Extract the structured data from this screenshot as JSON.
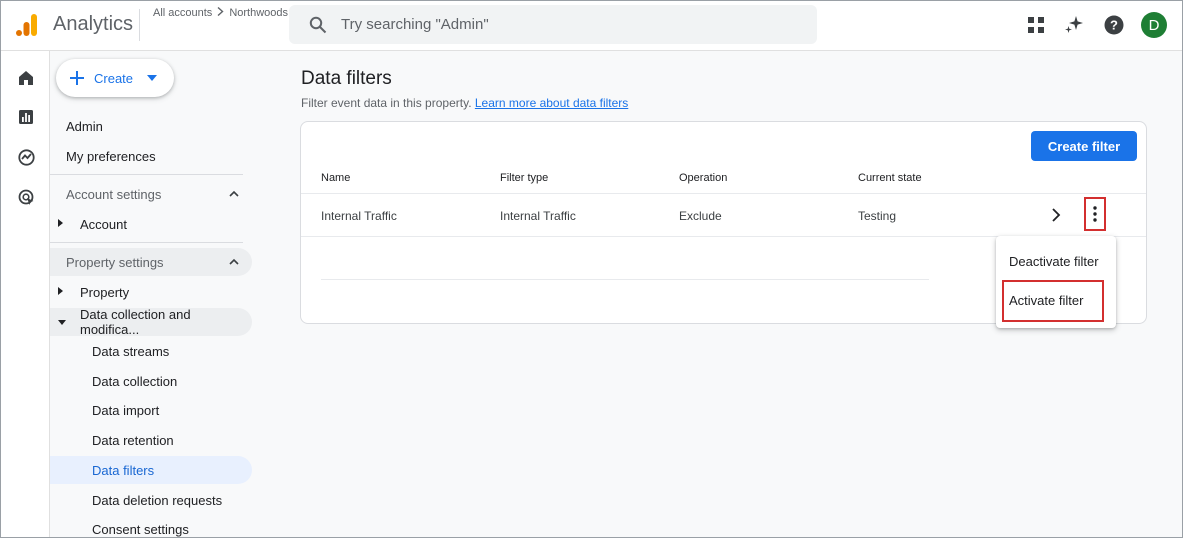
{
  "header": {
    "app_name": "Analytics",
    "breadcrumb": [
      "All accounts",
      "Northwoods"
    ],
    "search_placeholder": "Try searching \"Admin\"",
    "avatar_letter": "D",
    "icons": [
      "apps-grid-icon",
      "sparkle-icon",
      "help-icon"
    ]
  },
  "rail": {
    "icons": [
      "home-icon",
      "reports-icon",
      "explore-icon",
      "advertising-icon"
    ]
  },
  "sidebar": {
    "create_label": "Create",
    "admin_label": "Admin",
    "my_preferences_label": "My preferences",
    "account_settings_label": "Account settings",
    "account_label": "Account",
    "property_settings_label": "Property settings",
    "property_label": "Property",
    "data_collection_mod_label": "Data collection and modifica...",
    "sub_items": [
      "Data streams",
      "Data collection",
      "Data import",
      "Data retention",
      "Data filters",
      "Data deletion requests",
      "Consent settings"
    ],
    "active_item": "Data filters"
  },
  "main": {
    "title": "Data filters",
    "subtitle": "Filter event data in this property.",
    "learn_more": "Learn more about data filters",
    "create_filter_label": "Create filter",
    "columns": [
      "Name",
      "Filter type",
      "Operation",
      "Current state"
    ],
    "rows": [
      [
        "Internal Traffic",
        "Internal Traffic",
        "Exclude",
        "Testing"
      ]
    ]
  },
  "menu": {
    "items": [
      "Deactivate filter",
      "Activate filter"
    ],
    "highlighted": "Activate filter"
  },
  "colors": {
    "accent": "#1a73e8",
    "highlight_border": "#d32f2f",
    "avatar_bg": "#1e7e34",
    "active_nav_bg": "#e8f0fe"
  }
}
